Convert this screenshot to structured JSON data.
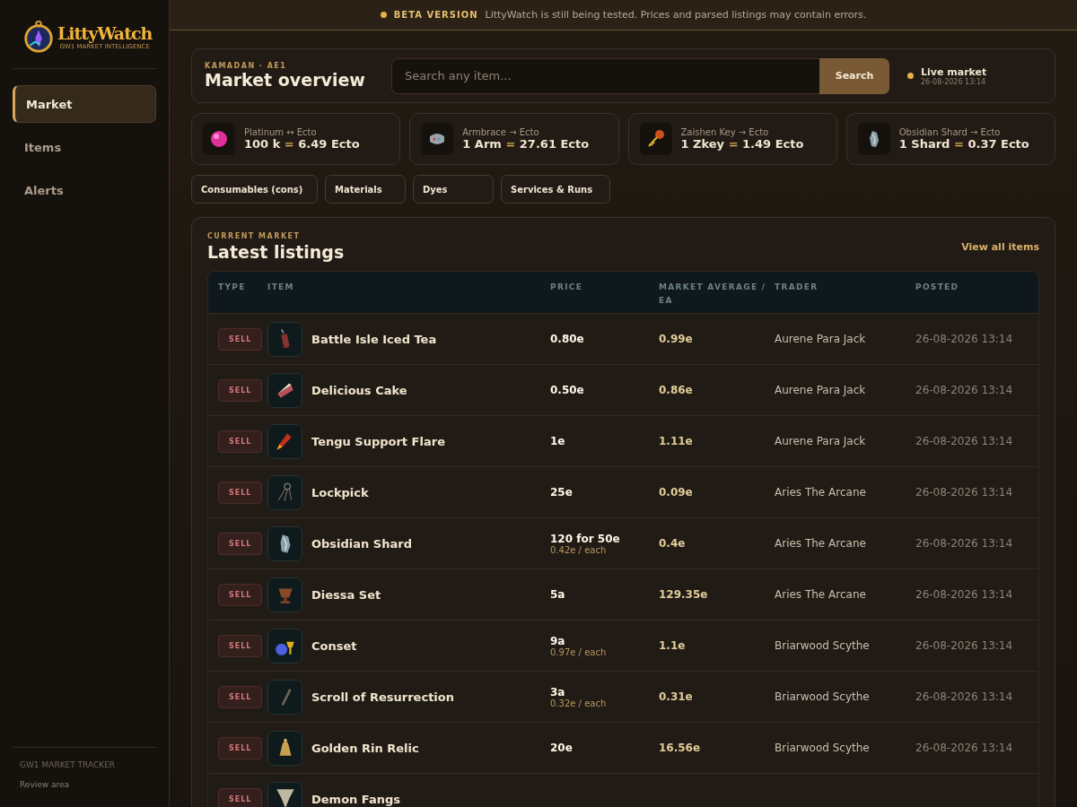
{
  "sidebar": {
    "logo": {
      "name": "LittyWatch",
      "tagline": "GW1 MARKET INTELLIGENCE"
    },
    "items": [
      {
        "label": "Market",
        "selected": true
      },
      {
        "label": "Items",
        "selected": false
      },
      {
        "label": "Alerts",
        "selected": false
      }
    ],
    "footer": {
      "title": "GW1 MARKET TRACKER",
      "link": "Review area"
    }
  },
  "banner": {
    "badge": "BETA VERSION",
    "message": "LittyWatch is still being tested. Prices and parsed listings may contain errors."
  },
  "header": {
    "eyebrow": "KAMADAN · AE1",
    "title": "Market overview",
    "search": {
      "placeholder": "Search any item...",
      "button": "Search"
    },
    "live": {
      "label": "Live market",
      "time": "26-08-2026 13:14"
    }
  },
  "rates": [
    {
      "title": "Platinum ↔ Ecto",
      "left": "100 k",
      "sign": "=",
      "right": "6.49 Ecto"
    },
    {
      "title": "Armbrace → Ecto",
      "left": "1 Arm",
      "sign": "=",
      "right": "27.61 Ecto"
    },
    {
      "title": "Zaishen Key → Ecto",
      "left": "1 Zkey",
      "sign": "=",
      "right": "1.49 Ecto"
    },
    {
      "title": "Obsidian Shard → Ecto",
      "left": "1 Shard",
      "sign": "=",
      "right": "0.37 Ecto"
    }
  ],
  "categories": [
    "Consumables (cons)",
    "Materials",
    "Dyes",
    "Services & Runs"
  ],
  "listings": {
    "eyebrow": "CURRENT MARKET",
    "title": "Latest listings",
    "view_all": "View all items",
    "columns": [
      "TYPE",
      "ITEM",
      "PRICE",
      "MARKET AVERAGE / EA",
      "TRADER",
      "POSTED"
    ],
    "rows": [
      {
        "type": "SELL",
        "item": "Battle Isle Iced Tea",
        "price": "0.80e",
        "average": "0.99e",
        "trader": "Aurene Para Jack",
        "posted": "26-08-2026 13:14"
      },
      {
        "type": "SELL",
        "item": "Delicious Cake",
        "price": "0.50e",
        "average": "0.86e",
        "trader": "Aurene Para Jack",
        "posted": "26-08-2026 13:14"
      },
      {
        "type": "SELL",
        "item": "Tengu Support Flare",
        "price": "1e",
        "average": "1.11e",
        "trader": "Aurene Para Jack",
        "posted": "26-08-2026 13:14"
      },
      {
        "type": "SELL",
        "item": "Lockpick",
        "price": "25e",
        "average": "0.09e",
        "trader": "Aries The Arcane",
        "posted": "26-08-2026 13:14"
      },
      {
        "type": "SELL",
        "item": "Obsidian Shard",
        "price": "120 for 50e",
        "each": "0.42e / each",
        "average": "0.4e",
        "trader": "Aries The Arcane",
        "posted": "26-08-2026 13:14"
      },
      {
        "type": "SELL",
        "item": "Diessa Set",
        "price": "5a",
        "average": "129.35e",
        "trader": "Aries The Arcane",
        "posted": "26-08-2026 13:14"
      },
      {
        "type": "SELL",
        "item": "Conset",
        "price": "9a",
        "each": "0.97e / each",
        "average": "1.1e",
        "trader": "Briarwood Scythe",
        "posted": "26-08-2026 13:14"
      },
      {
        "type": "SELL",
        "item": "Scroll of Resurrection",
        "price": "3a",
        "each": "0.32e / each",
        "average": "0.31e",
        "trader": "Briarwood Scythe",
        "posted": "26-08-2026 13:14"
      },
      {
        "type": "SELL",
        "item": "Golden Rin Relic",
        "price": "20e",
        "average": "16.56e",
        "trader": "Briarwood Scythe",
        "posted": "26-08-2026 13:14"
      },
      {
        "type": "SELL",
        "item": "Demon Fangs"
      }
    ]
  }
}
